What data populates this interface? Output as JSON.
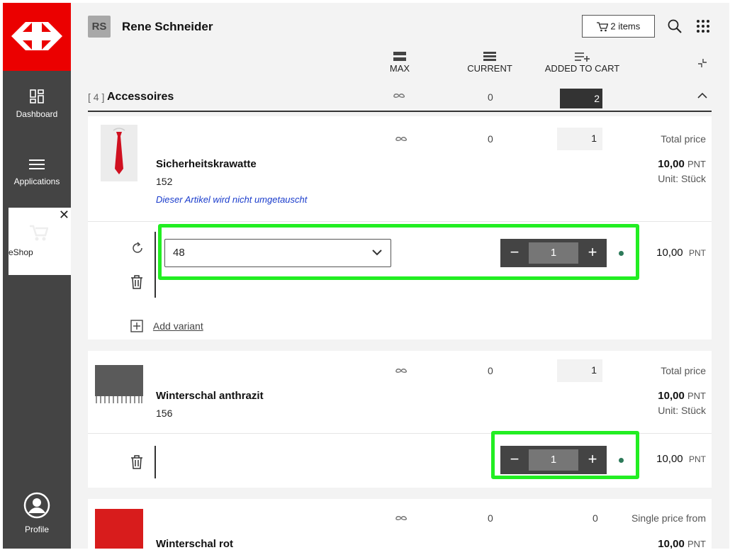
{
  "sidebar": {
    "items": [
      {
        "label": "Dashboard",
        "icon": "dashboard-icon"
      },
      {
        "label": "Applications",
        "icon": "menu-icon"
      },
      {
        "label": "eShop",
        "icon": "cart-icon"
      },
      {
        "label": "Profile",
        "icon": "profile-icon"
      }
    ]
  },
  "header": {
    "initials": "RS",
    "user_name": "Rene  Schneider",
    "cart_label": "2 items"
  },
  "columns": {
    "max": "MAX",
    "current": "CURRENT",
    "added": "ADDED TO CART"
  },
  "category": {
    "count": "[ 4 ]",
    "name": "Accessoires",
    "current": "0",
    "added": "2"
  },
  "products": [
    {
      "name": "Sicherheitskrawatte",
      "number": "152",
      "note": "Dieser Artikel wird nicht umgetauscht",
      "current": "0",
      "quantity": "1",
      "price_label": "Total price",
      "price": "10,00",
      "currency": "PNT",
      "unit": "Unit: Stück",
      "variant": {
        "size": "48",
        "qty": "1",
        "line_price": "10,00",
        "currency": "PNT"
      },
      "add_variant": "Add variant"
    },
    {
      "name": "Winterschal anthrazit",
      "number": "156",
      "current": "0",
      "quantity": "1",
      "price_label": "Total price",
      "price": "10,00",
      "currency": "PNT",
      "unit": "Unit: Stück",
      "variant": {
        "qty": "1",
        "line_price": "10,00",
        "currency": "PNT"
      }
    },
    {
      "name": "Winterschal rot",
      "current": "0",
      "quantity": "0",
      "price_label": "Single price from",
      "price": "10,00",
      "currency": "PNT"
    }
  ],
  "colors": {
    "brand_red": "#eb0000",
    "sidebar": "#444444",
    "highlight": "#22ee22",
    "status_dot": "#2d7a5a"
  }
}
